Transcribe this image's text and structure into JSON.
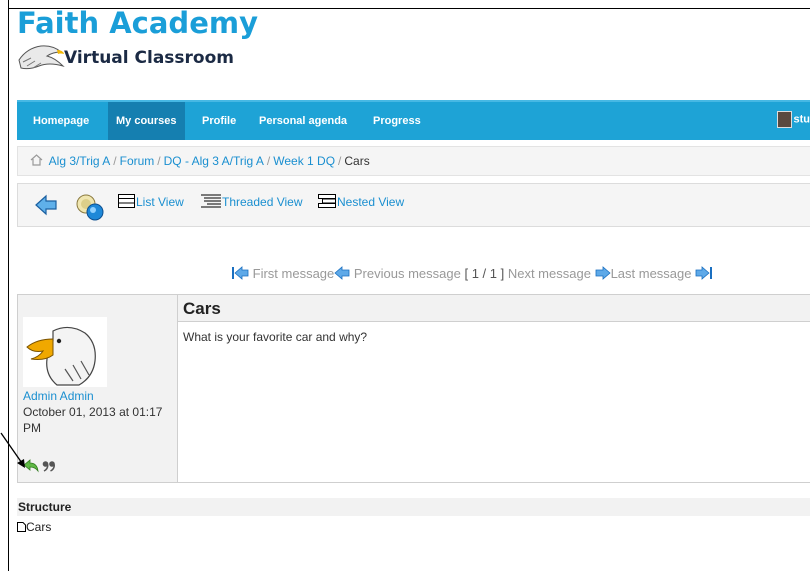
{
  "header": {
    "title": "Faith Academy",
    "subtitle": "Virtual Classroom"
  },
  "nav": {
    "items": [
      {
        "label": "Homepage",
        "active": false
      },
      {
        "label": "My courses",
        "active": true
      },
      {
        "label": "Profile",
        "active": false
      },
      {
        "label": "Personal agenda",
        "active": false
      },
      {
        "label": "Progress",
        "active": false
      }
    ],
    "user_label": "stu"
  },
  "breadcrumb": {
    "items": [
      "Alg 3/Trig A",
      "Forum",
      "DQ - Alg 3 A/Trig A",
      "Week 1 DQ"
    ],
    "current": "Cars"
  },
  "toolbar": {
    "list_view": "List View",
    "threaded_view": "Threaded View",
    "nested_view": "Nested View"
  },
  "pager": {
    "first": "First message",
    "previous": "Previous message",
    "position": "[ 1 / 1 ]",
    "next": "Next message",
    "last": "Last message"
  },
  "post": {
    "title": "Cars",
    "body": "What is your favorite car and why?",
    "author": "Admin Admin",
    "date": "October 01, 2013 at 01:17 PM"
  },
  "structure": {
    "heading": "Structure",
    "items": [
      "Cars"
    ]
  },
  "colors": {
    "brand": "#1a9ed8",
    "nav_bg": "#1ea3d6",
    "nav_active": "#157fb0",
    "link": "#1a8fd0"
  },
  "icons": [
    "home-icon",
    "back-arrow-icon",
    "search-icon",
    "list-view-icon",
    "threaded-view-icon",
    "nested-view-icon",
    "first-icon",
    "previous-icon",
    "next-icon",
    "last-icon",
    "reply-icon",
    "quote-icon",
    "document-icon"
  ]
}
